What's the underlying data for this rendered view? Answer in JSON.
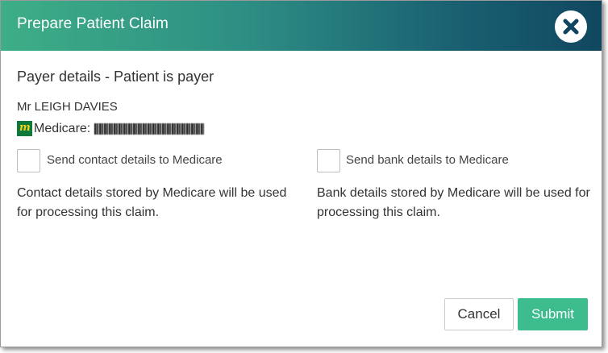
{
  "dialog": {
    "title": "Prepare Patient Claim",
    "close_icon": "close-icon"
  },
  "payer": {
    "heading": "Payer details - Patient is payer",
    "patient_name": "Mr LEIGH DAVIES",
    "medicare_logo_letter": "m",
    "medicare_label": "Medicare:"
  },
  "options": {
    "contact_checkbox_label": "Send contact details to Medicare",
    "contact_checked": false,
    "contact_description": "Contact details stored by Medicare will be used for processing this claim.",
    "bank_checkbox_label": "Send bank details to Medicare",
    "bank_checked": false,
    "bank_description": "Bank details stored by Medicare will be used for processing this claim."
  },
  "buttons": {
    "cancel": "Cancel",
    "submit": "Submit"
  },
  "colors": {
    "header_gradient_start": "#3dae86",
    "header_gradient_end": "#10475f",
    "submit_background": "#3dbd8d",
    "medicare_logo": "#0d7a3a"
  }
}
